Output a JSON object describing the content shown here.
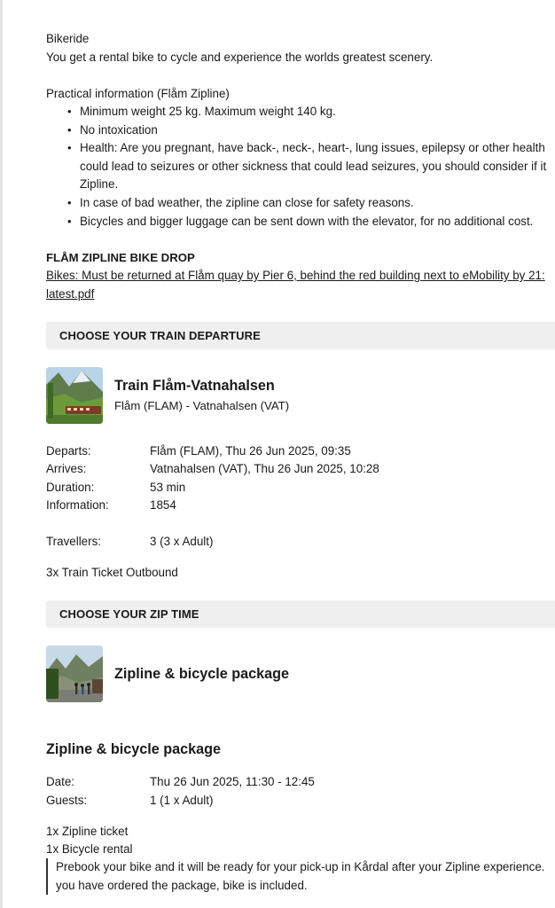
{
  "bike": {
    "heading": "Bikeride",
    "text": "You get a rental bike to cycle and experience the worlds greatest scenery."
  },
  "practical": {
    "heading": "Practical information (Flåm Zipline)",
    "bullets": [
      "Minimum weight 25 kg. Maximum weight 140 kg.",
      "No intoxication",
      "Health: Are you pregnant, have back-, neck-, heart-, lung issues, epilepsy or other health",
      "could lead to seizures or other sickness that could lead seizures, you should consider if it",
      "Zipline.",
      "In case of bad weather, the zipline can close for safety reasons.",
      "Bicycles and bigger luggage can be sent down with the elevator, for no additional cost."
    ]
  },
  "bike_drop": {
    "heading": "FLÅM ZIPLINE BIKE DROP",
    "link_line1": "Bikes: Must be returned at Flåm quay by Pier 6, behind the red building next to eMobility by 21:",
    "link_line2": "latest.pdf"
  },
  "train_section": {
    "bar_label": "CHOOSE YOUR TRAIN DEPARTURE",
    "title": "Train Flåm-Vatnahalsen",
    "route": "Flåm (FLAM) - Vatnahalsen (VAT)",
    "details": [
      {
        "label": "Departs:",
        "value": "Flåm (FLAM), Thu 26 Jun 2025, 09:35"
      },
      {
        "label": "Arrives:",
        "value": "Vatnahalsen (VAT), Thu 26 Jun 2025, 10:28"
      },
      {
        "label": "Duration:",
        "value": "53 min"
      },
      {
        "label": "Information:",
        "value": "1854"
      }
    ],
    "travellers_label": "Travellers:",
    "travellers_value": "3 (3 x Adult)",
    "ticket_line": "3x Train Ticket Outbound"
  },
  "zip_section": {
    "bar_label": "CHOOSE YOUR ZIP TIME",
    "item_title": "Zipline & bicycle package",
    "package_heading": "Zipline & bicycle package",
    "details": [
      {
        "label": "Date:",
        "value": "Thu 26 Jun 2025, 11:30 - 12:45"
      },
      {
        "label": "Guests:",
        "value": "1 (1 x Adult)"
      }
    ],
    "items": [
      "1x Zipline ticket",
      "1x Bicycle rental"
    ],
    "note_line1": "Prebook your bike and it will be ready for your pick-up in Kårdal after your Zipline experience.",
    "note_line2": "you have ordered the package, bike is included."
  },
  "colors": {
    "section_bar": "#efefef",
    "text": "#1a1a1a"
  }
}
